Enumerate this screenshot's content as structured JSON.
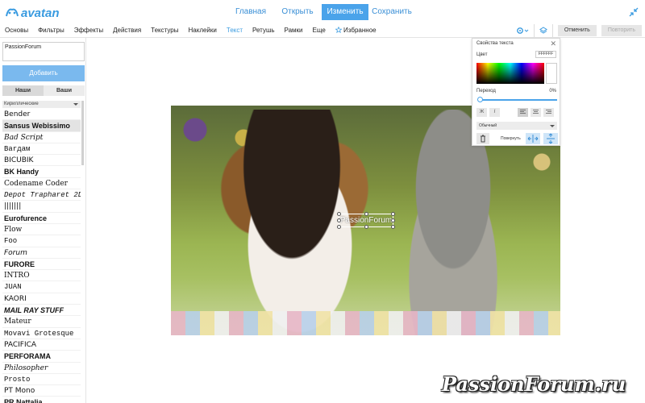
{
  "app": {
    "logo_text": "avatan"
  },
  "main_tabs": [
    {
      "label": "Главная"
    },
    {
      "label": "Открыть"
    },
    {
      "label": "Изменить",
      "active": true
    },
    {
      "label": "Сохранить"
    }
  ],
  "tools": [
    {
      "label": "Основы"
    },
    {
      "label": "Фильтры"
    },
    {
      "label": "Эффекты"
    },
    {
      "label": "Действия"
    },
    {
      "label": "Текстуры"
    },
    {
      "label": "Наклейки"
    },
    {
      "label": "Текст",
      "active": true
    },
    {
      "label": "Ретушь"
    },
    {
      "label": "Рамки"
    },
    {
      "label": "Еще"
    },
    {
      "label": "Избранное"
    }
  ],
  "history": {
    "undo_label": "Отменить",
    "redo_label": "Повторить"
  },
  "left_panel": {
    "text_value": "PassionForum",
    "add_button": "Добавить",
    "segments": {
      "ours": "Наши",
      "yours": "Ваши"
    },
    "category": "Кириллические",
    "fonts": [
      "Bender",
      "Sansus Webissimo",
      "Bad Script",
      "Barдам",
      "BICUBIK",
      "BK Handy",
      "Codename Coder",
      "Depot Trapharet 2D",
      "|||||||",
      "Eurofurence",
      "Flow",
      "Foo",
      "Forum",
      "FURORE",
      "INTRO",
      "JUAN",
      "KAORI",
      "MAIL RAY STUFF",
      "Mateur",
      "Movavi Grotesque",
      "PACIFICA",
      "PERFORAMA",
      "Philosopher",
      "Prosto",
      "PT Mono",
      "PR Nattalia"
    ],
    "selected_font": "Sansus Webissimo"
  },
  "canvas": {
    "text_object": "PassionForum"
  },
  "text_props": {
    "title": "Свойства текста",
    "color_label": "Цвет",
    "color_value": "FFFFFF",
    "transition_label": "Переход",
    "transition_value": "0%",
    "style_select": "Обычный",
    "rotate_label": "Повернуть",
    "bold_glyph": "Ж",
    "italic_glyph": "I"
  },
  "watermark": "PassionForum.ru",
  "colors": {
    "accent": "#4aa3ea",
    "link": "#3a8fd6"
  }
}
